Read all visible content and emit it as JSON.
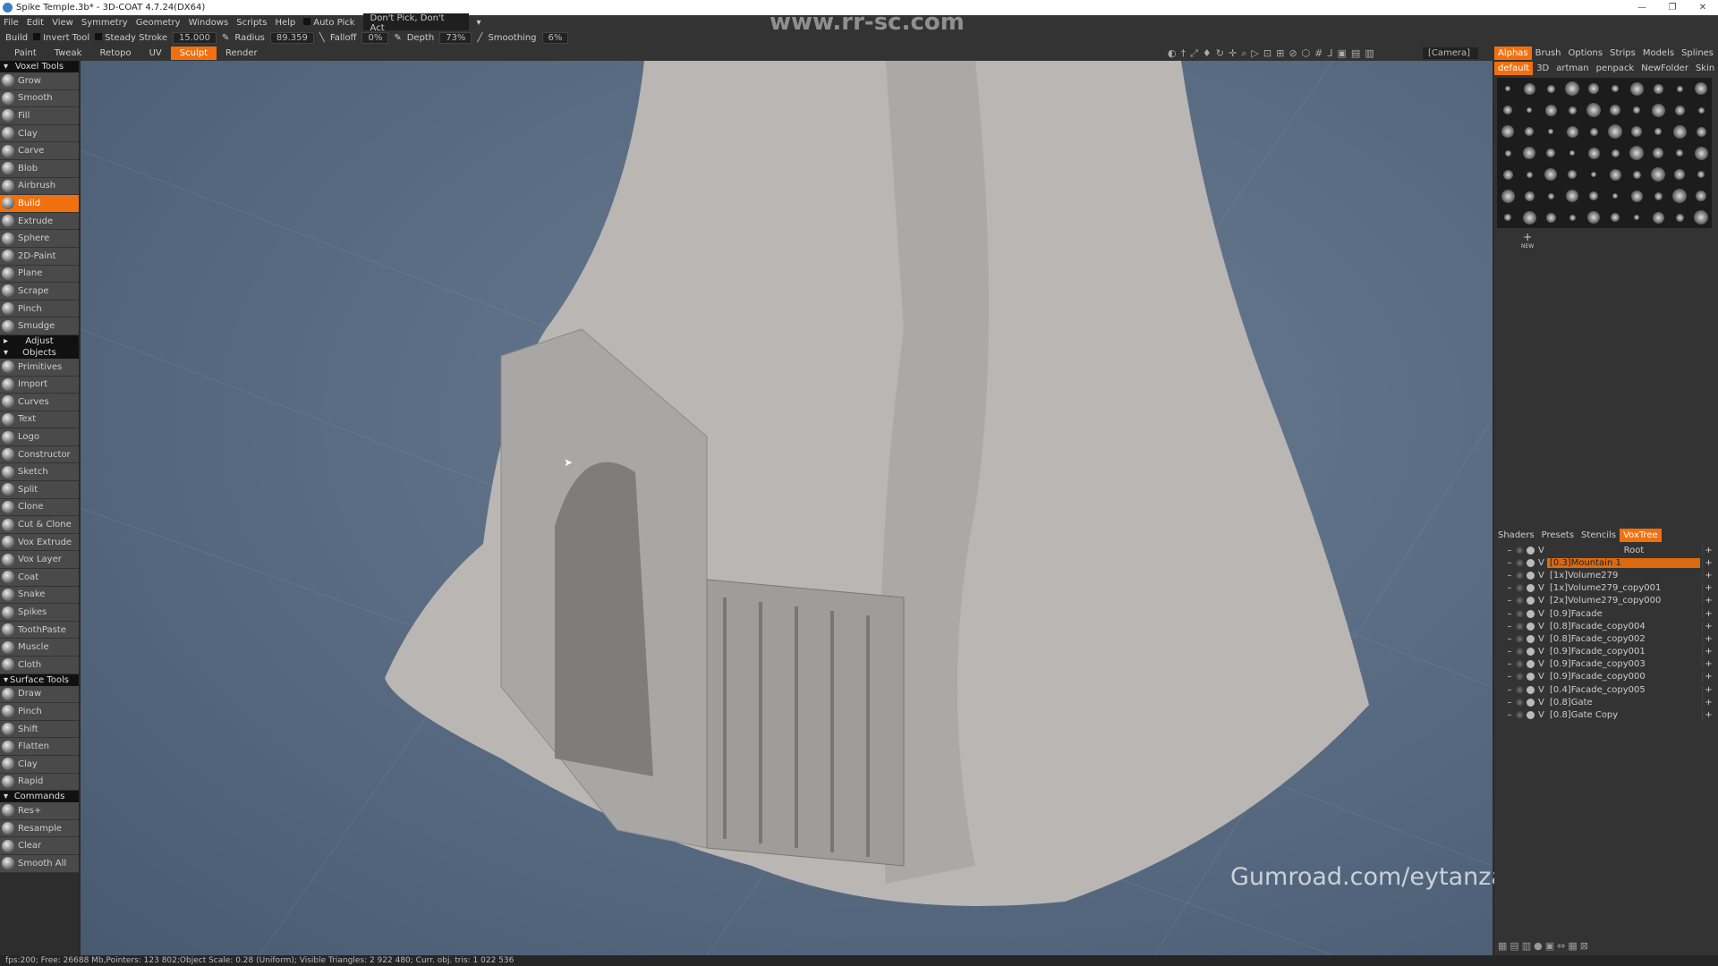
{
  "window": {
    "title": "Spike Temple.3b* - 3D-COAT 4.7.24(DX64)",
    "controls": [
      "—",
      "❐",
      "✕"
    ]
  },
  "watermark": {
    "site": "www.rr-sc.com",
    "gumroad": "Gumroad.com/eytanzanana"
  },
  "menu": {
    "items": [
      "File",
      "Edit",
      "View",
      "Symmetry",
      "Geometry",
      "Windows",
      "Scripts",
      "Help"
    ],
    "auto_pick": "Auto Pick",
    "pick_mode": "Don't Pick, Don't Act"
  },
  "toolbar": {
    "tool": "Build",
    "invert": "Invert Tool",
    "steady": "Steady Stroke",
    "steady_value": "15.000",
    "radius_label": "Radius",
    "radius": "89.359",
    "falloff_label": "Falloff",
    "falloff": "0%",
    "depth_label": "Depth",
    "depth": "73%",
    "smoothing_label": "Smoothing",
    "smoothing": "6%"
  },
  "tabs": [
    "Paint",
    "Tweak",
    "Retopo",
    "UV",
    "Sculpt",
    "Render"
  ],
  "active_tab": "Sculpt",
  "camera": "[Camera]",
  "left_panel": {
    "voxel_header": "Voxel Tools",
    "voxel_tools": [
      "Grow",
      "Smooth",
      "Fill",
      "Clay",
      "Carve",
      "Blob",
      "Airbrush",
      "Build",
      "Extrude",
      "Sphere",
      "2D-Paint",
      "Plane",
      "Scrape",
      "Pinch",
      "Smudge"
    ],
    "adjust_header": "Adjust",
    "objects_header": "Objects",
    "objects": [
      "Primitives",
      "Import",
      "Curves",
      "Text",
      "Logo",
      "Constructor",
      "Sketch",
      "Split",
      "Clone",
      "Cut & Clone",
      "Vox Extrude",
      "Vox Layer",
      "Coat",
      "Snake",
      "Spikes",
      "ToothPaste",
      "Muscle",
      "Cloth"
    ],
    "surface_header": "Surface Tools",
    "surface_tools": [
      "Draw",
      "Pinch",
      "Shift",
      "Flatten",
      "Clay",
      "Rapid"
    ],
    "commands_header": "Commands",
    "commands": [
      "Res+",
      "Resample",
      "Clear",
      "Smooth All"
    ],
    "active_tool": "Build"
  },
  "right_panel": {
    "tabs": [
      "Alphas",
      "Brush",
      "Options",
      "Strips",
      "Models",
      "Splines"
    ],
    "folders": [
      "default",
      "3D",
      "artman",
      "penpack",
      "NewFolder",
      "Skin"
    ],
    "new_label": "NEW",
    "lower_tabs": [
      "Shaders",
      "Presets",
      "Stencils",
      "VoxTree"
    ],
    "tree": [
      "Root",
      "[0.3]Mountain 1",
      "[1x]Volume279",
      "[1x]Volume279_copy001",
      "[2x]Volume279_copy000",
      "[0.9]Facade",
      "[0.8]Facade_copy004",
      "[0.8]Facade_copy002",
      "[0.9]Facade_copy001",
      "[0.9]Facade_copy003",
      "[0.9]Facade_copy000",
      "[0.4]Facade_copy005",
      "[0.8]Gate",
      "[0.8]Gate Copy"
    ],
    "active_layer": "[0.3]Mountain 1"
  },
  "status": "fps:200;  Free: 26688 Mb,Pointers: 123 802;Object Scale: 0.28 (Uniform); Visible Triangles: 2 922 480; Curr. obj. tris: 1 022 536",
  "colors": {
    "accent": "#f07010",
    "viewport": "#56697f"
  }
}
